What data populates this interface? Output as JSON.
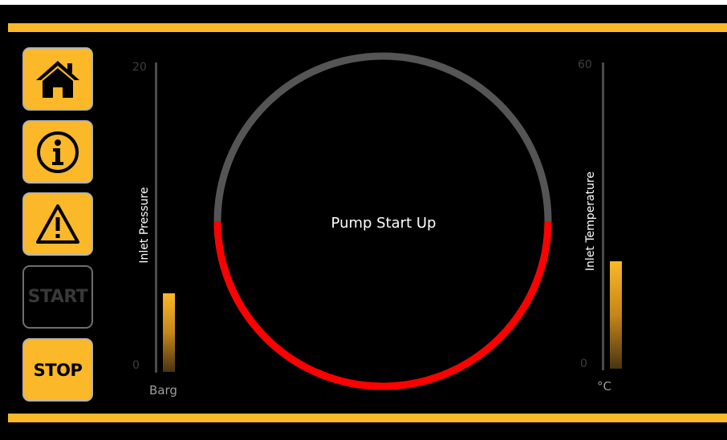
{
  "colors": {
    "accent": "#fbb828",
    "gauge_track": "#555555",
    "gauge_active": "#ff0000",
    "background": "#000000"
  },
  "nav": {
    "home_icon": "home-icon",
    "info_icon": "info-icon",
    "warning_icon": "warning-icon",
    "start_label": "START",
    "stop_label": "STOP"
  },
  "pressure": {
    "label": "Inlet Pressure",
    "max_tick": "20",
    "min_tick": "0",
    "unit": "Barg",
    "level_fraction": 0.26
  },
  "temperature": {
    "label": "Inlet Temperature",
    "max_tick": "60",
    "min_tick": "0",
    "unit": "°C",
    "level_fraction": 0.36
  },
  "gauge": {
    "status_text": "Pump Start Up",
    "progress_fraction": 0.5
  }
}
